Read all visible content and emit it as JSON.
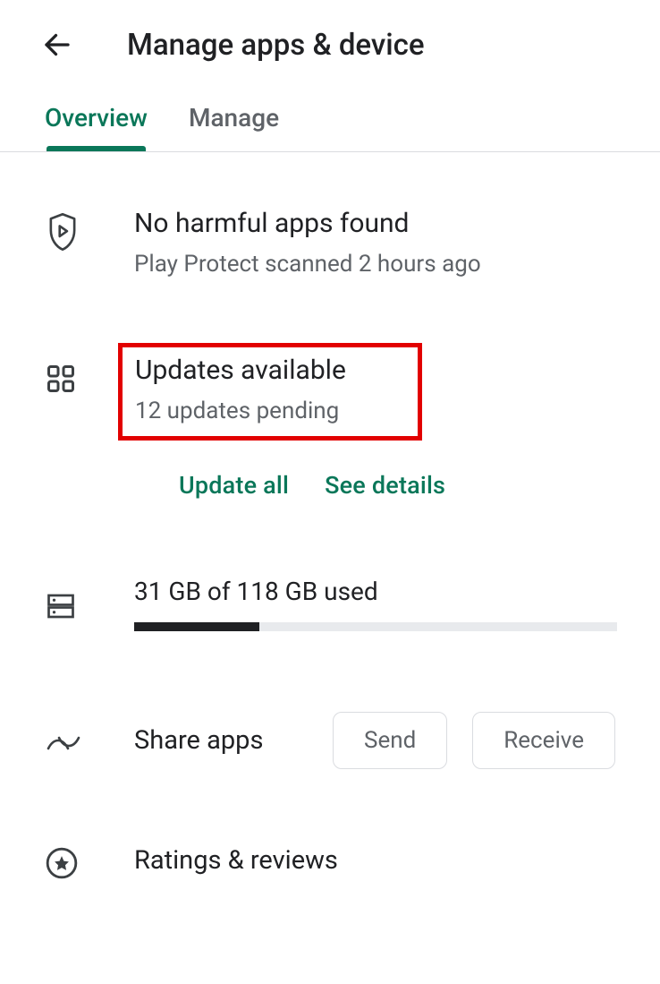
{
  "header": {
    "title": "Manage apps & device"
  },
  "tabs": {
    "overview": "Overview",
    "manage": "Manage"
  },
  "protect": {
    "title": "No harmful apps found",
    "subtitle": "Play Protect scanned 2 hours ago"
  },
  "updates": {
    "title": "Updates available",
    "subtitle": "12 updates pending",
    "update_all": "Update all",
    "see_details": "See details"
  },
  "storage": {
    "label": "31 GB of 118 GB used",
    "used_gb": 31,
    "total_gb": 118,
    "percent": 26
  },
  "share": {
    "label": "Share apps",
    "send": "Send",
    "receive": "Receive"
  },
  "ratings": {
    "label": "Ratings & reviews"
  }
}
